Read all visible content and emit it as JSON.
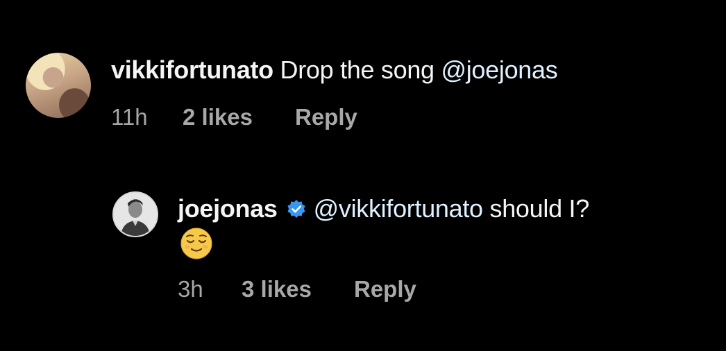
{
  "comments": [
    {
      "username": "vikkifortunato",
      "text": "Drop the song",
      "mention": "@joejonas",
      "time": "11h",
      "likes": "2 likes",
      "reply": "Reply"
    },
    {
      "username": "joejonas",
      "verified": true,
      "mention": "@vikkifortunato",
      "text": "should I?",
      "emoji": "relieved-face",
      "time": "3h",
      "likes": "3 likes",
      "reply": "Reply"
    }
  ],
  "colors": {
    "background": "#000000",
    "text": "#f5f5f5",
    "meta": "#a8a8a8",
    "verified": "#3897f0",
    "emoji": "#f7c948"
  }
}
